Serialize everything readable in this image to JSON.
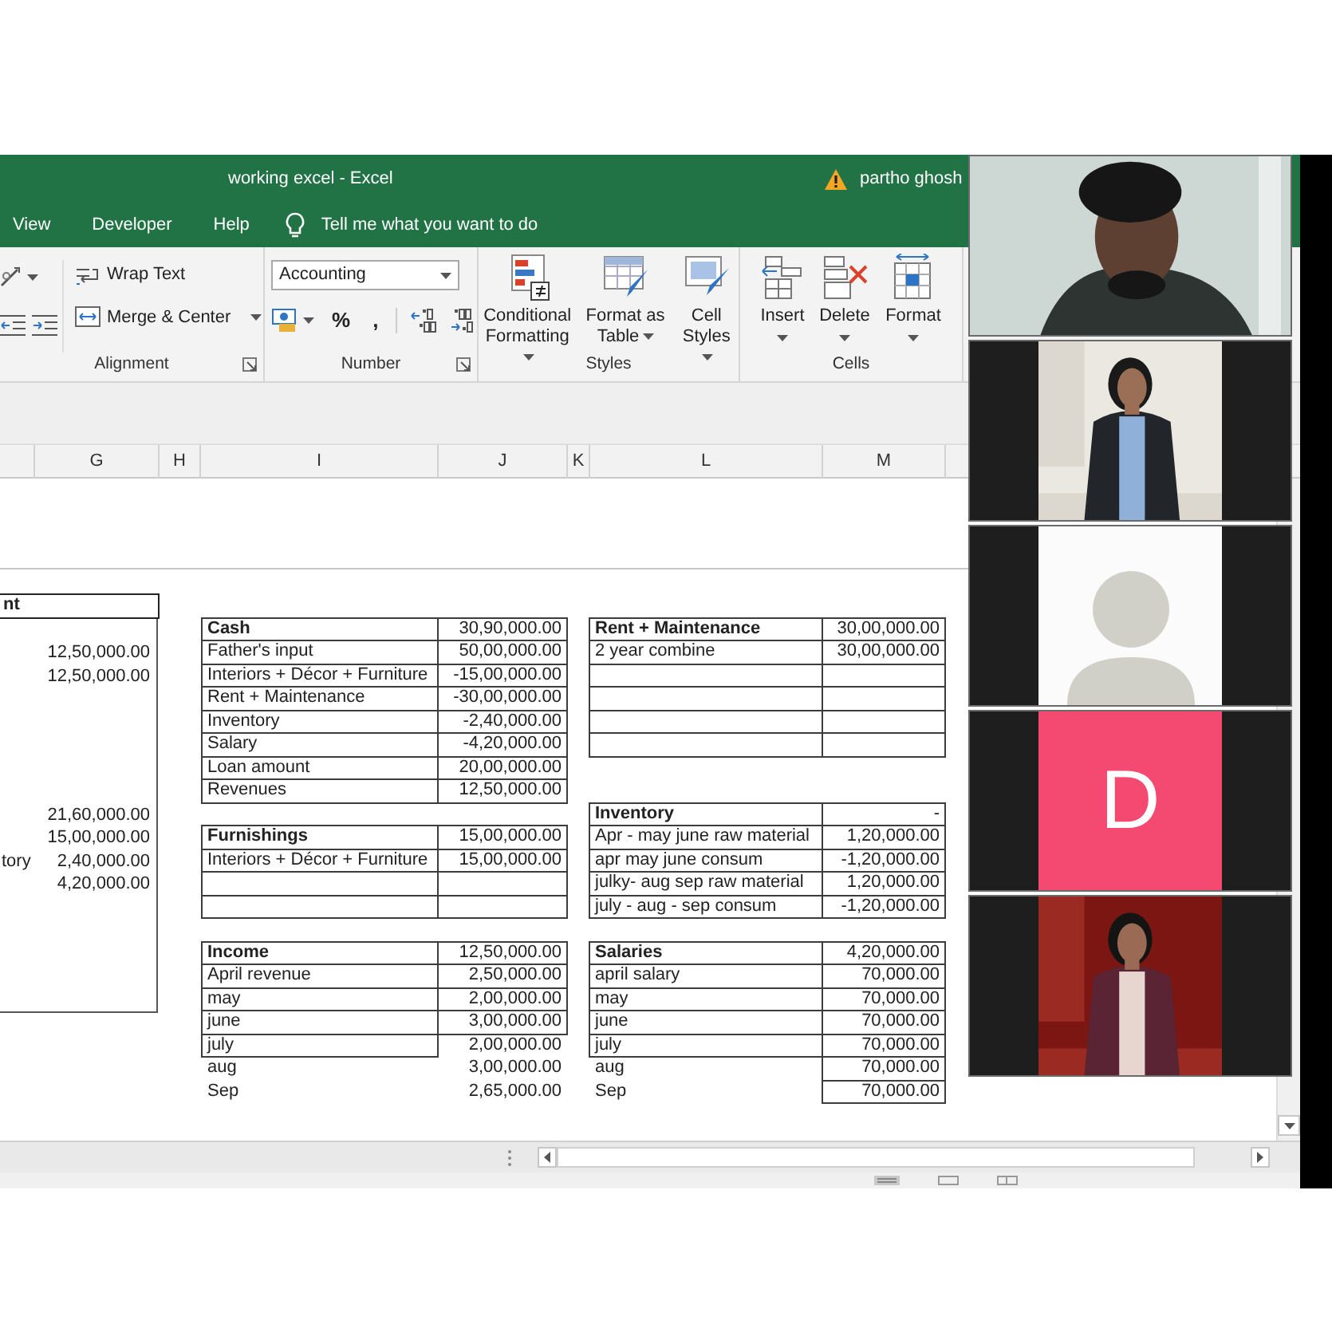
{
  "window": {
    "title": "working excel  -  Excel",
    "user": "partho ghosh"
  },
  "ribbon_tabs": [
    {
      "label": "View"
    },
    {
      "label": "Developer"
    },
    {
      "label": "Help"
    }
  ],
  "tell_me": {
    "placeholder": "Tell me what you want to do"
  },
  "ribbon_groups": [
    {
      "kind": "alignment",
      "label": "Alignment",
      "launcher": true,
      "commands": [
        {
          "label": "Wrap Text",
          "dropdown": false
        },
        {
          "label": "Merge & Center",
          "dropdown": true
        }
      ]
    },
    {
      "kind": "number",
      "label": "Number",
      "launcher": true,
      "format": "Accounting",
      "symbols": [
        "%",
        ","
      ]
    },
    {
      "kind": "styles",
      "label": "Styles",
      "commands": [
        {
          "label": "Conditional Formatting",
          "dropdown": true
        },
        {
          "label": "Format as Table",
          "dropdown": true
        },
        {
          "label": "Cell Styles",
          "dropdown": true
        }
      ]
    },
    {
      "kind": "cells",
      "label": "Cells",
      "commands": [
        {
          "label": "Insert",
          "dropdown": true
        },
        {
          "label": "Delete",
          "dropdown": true
        },
        {
          "label": "Format",
          "dropdown": true
        }
      ]
    }
  ],
  "columns": [
    "G",
    "H",
    "I",
    "J",
    "K",
    "L",
    "M"
  ],
  "sheet": {
    "left_table": {
      "header": "nt",
      "rows": [
        {
          "kind": "blank"
        },
        {
          "kind": "entry",
          "value": "12,50,000.00"
        },
        {
          "kind": "entry",
          "value": "12,50,000.00"
        },
        {
          "kind": "blank"
        },
        {
          "kind": "blank"
        },
        {
          "kind": "blank"
        },
        {
          "kind": "blank"
        },
        {
          "kind": "blank"
        },
        {
          "kind": "entry",
          "value": "21,60,000.00"
        },
        {
          "kind": "entry",
          "value": "15,00,000.00"
        },
        {
          "kind": "entry",
          "label": "tory",
          "value": "2,40,000.00"
        },
        {
          "kind": "entry",
          "value": "4,20,000.00"
        },
        {
          "kind": "blank"
        },
        {
          "kind": "blank"
        },
        {
          "kind": "blank"
        },
        {
          "kind": "blank"
        },
        {
          "kind": "blank"
        }
      ]
    },
    "middle_tables": [
      {
        "rows": [
          {
            "kind": "head",
            "label": "Cash",
            "value": "30,90,000.00"
          },
          {
            "kind": "boxed",
            "label": "Father's input",
            "value": "50,00,000.00"
          },
          {
            "kind": "boxed",
            "label": "Interiors + Décor + Furniture",
            "value": "-15,00,000.00"
          },
          {
            "kind": "boxed",
            "label": "Rent + Maintenance",
            "value": "-30,00,000.00"
          },
          {
            "kind": "boxed",
            "label": "Inventory",
            "value": "-2,40,000.00"
          },
          {
            "kind": "boxed",
            "label": "Salary",
            "value": "-4,20,000.00"
          },
          {
            "kind": "boxed",
            "label": "Loan amount",
            "value": "20,00,000.00"
          },
          {
            "kind": "boxed",
            "label": "Revenues",
            "value": "12,50,000.00"
          }
        ]
      },
      {
        "rows": [
          {
            "kind": "head",
            "label": "Furnishings",
            "value": "15,00,000.00"
          },
          {
            "kind": "boxed",
            "label": "Interiors + Décor + Furniture",
            "value": "15,00,000.00"
          },
          {
            "kind": "blank"
          },
          {
            "kind": "blank"
          }
        ]
      },
      {
        "rows": [
          {
            "kind": "head",
            "label": "Income",
            "value": "12,50,000.00"
          },
          {
            "kind": "boxed",
            "label": "April revenue",
            "value": "2,50,000.00"
          },
          {
            "kind": "boxed",
            "label": "may",
            "value": "2,00,000.00"
          },
          {
            "kind": "boxed",
            "label": "june",
            "value": "3,00,000.00"
          },
          {
            "kind": "label-boxed",
            "label": "july",
            "value": "2,00,000.00"
          },
          {
            "kind": "plain",
            "label": "aug",
            "value": "3,00,000.00"
          },
          {
            "kind": "plain",
            "label": "Sep",
            "value": "2,65,000.00"
          }
        ]
      }
    ],
    "right_tables": [
      {
        "rows": [
          {
            "kind": "head",
            "label": "Rent + Maintenance",
            "value": "30,00,000.00"
          },
          {
            "kind": "boxed",
            "label": "2 year combine",
            "value": "30,00,000.00"
          },
          {
            "kind": "blank"
          },
          {
            "kind": "blank"
          },
          {
            "kind": "blank"
          },
          {
            "kind": "blank"
          }
        ]
      },
      {
        "rows": [
          {
            "kind": "head",
            "label": "Inventory",
            "value": "-"
          },
          {
            "kind": "boxed",
            "label": "Apr - may june raw material",
            "value": "1,20,000.00"
          },
          {
            "kind": "boxed",
            "label": "apr may june consum",
            "value": "-1,20,000.00"
          },
          {
            "kind": "boxed",
            "label": "julky- aug sep raw material",
            "value": "1,20,000.00"
          },
          {
            "kind": "boxed",
            "label": "july - aug - sep consum",
            "value": "-1,20,000.00"
          }
        ]
      },
      {
        "rows": [
          {
            "kind": "head",
            "label": "Salaries",
            "value": "4,20,000.00"
          },
          {
            "kind": "boxed",
            "label": "april salary",
            "value": "70,000.00"
          },
          {
            "kind": "boxed",
            "label": "may",
            "value": "70,000.00"
          },
          {
            "kind": "boxed",
            "label": "june",
            "value": "70,000.00"
          },
          {
            "kind": "boxed",
            "label": "july",
            "value": "70,000.00"
          },
          {
            "kind": "value-boxed",
            "label": "aug",
            "value": "70,000.00"
          },
          {
            "kind": "value-boxed",
            "label": "Sep",
            "value": "70,000.00"
          }
        ]
      }
    ]
  },
  "video_tiles": [
    {
      "kind": "video"
    },
    {
      "kind": "portrait"
    },
    {
      "kind": "avatar"
    },
    {
      "kind": "initial",
      "initial": "D",
      "color": "#f44a72"
    },
    {
      "kind": "portrait"
    }
  ]
}
